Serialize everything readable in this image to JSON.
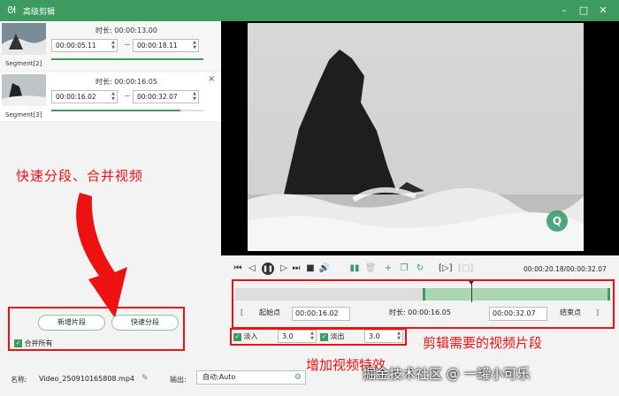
{
  "window": {
    "title": "高级剪辑",
    "logo": "rabbit-logo-icon"
  },
  "segments": [
    {
      "label": "Segment[2]",
      "duration_label": "时长:",
      "duration": "00:00:13.00",
      "start": "00:00:05.11",
      "end": "00:00:18.11",
      "progress": 1.0
    },
    {
      "label": "Segment[3]",
      "duration_label": "时长:",
      "duration": "00:00:16.05",
      "start": "00:00:16.02",
      "end": "00:00:32.07",
      "progress": 0.85,
      "close": "×"
    }
  ],
  "annotations": {
    "left": "快速分段、合并视频",
    "timeline": "剪辑需要的视频片段",
    "effects": "增加视频特效",
    "site_watermark": "掘金技术社区 @ 一罐小可乐"
  },
  "buttons": {
    "add_segment": "新增片段",
    "quick_split": "快速分段",
    "merge_all": "合并所有"
  },
  "footer": {
    "name_label": "名称:",
    "file_name": "Video_250910165808.mp4",
    "output_label": "输出:",
    "output_value": "自动;Auto"
  },
  "player": {
    "current_time": "00:00:20.18",
    "total_time": "00:00:32.07",
    "time_display": "00:00:20.18/00:00:32.07",
    "watermark_letter": "Q"
  },
  "trim": {
    "start_button": "起始点",
    "start_time": "00:00:16.02",
    "duration_label": "时长:",
    "duration": "00:00:16.05",
    "end_time": "00:00:32.07",
    "end_button": "结束点",
    "left_bracket": "[",
    "right_bracket": "]",
    "selection_start_fraction": 0.5,
    "selection_end_fraction": 1.0,
    "playhead_fraction": 0.63
  },
  "effects": {
    "fade_in_label": "淡入",
    "fade_in_value": "3.0",
    "fade_out_label": "淡出",
    "fade_out_value": "3.0"
  },
  "colors": {
    "accent": "#3d9b62",
    "annotation": "#ee1111"
  }
}
